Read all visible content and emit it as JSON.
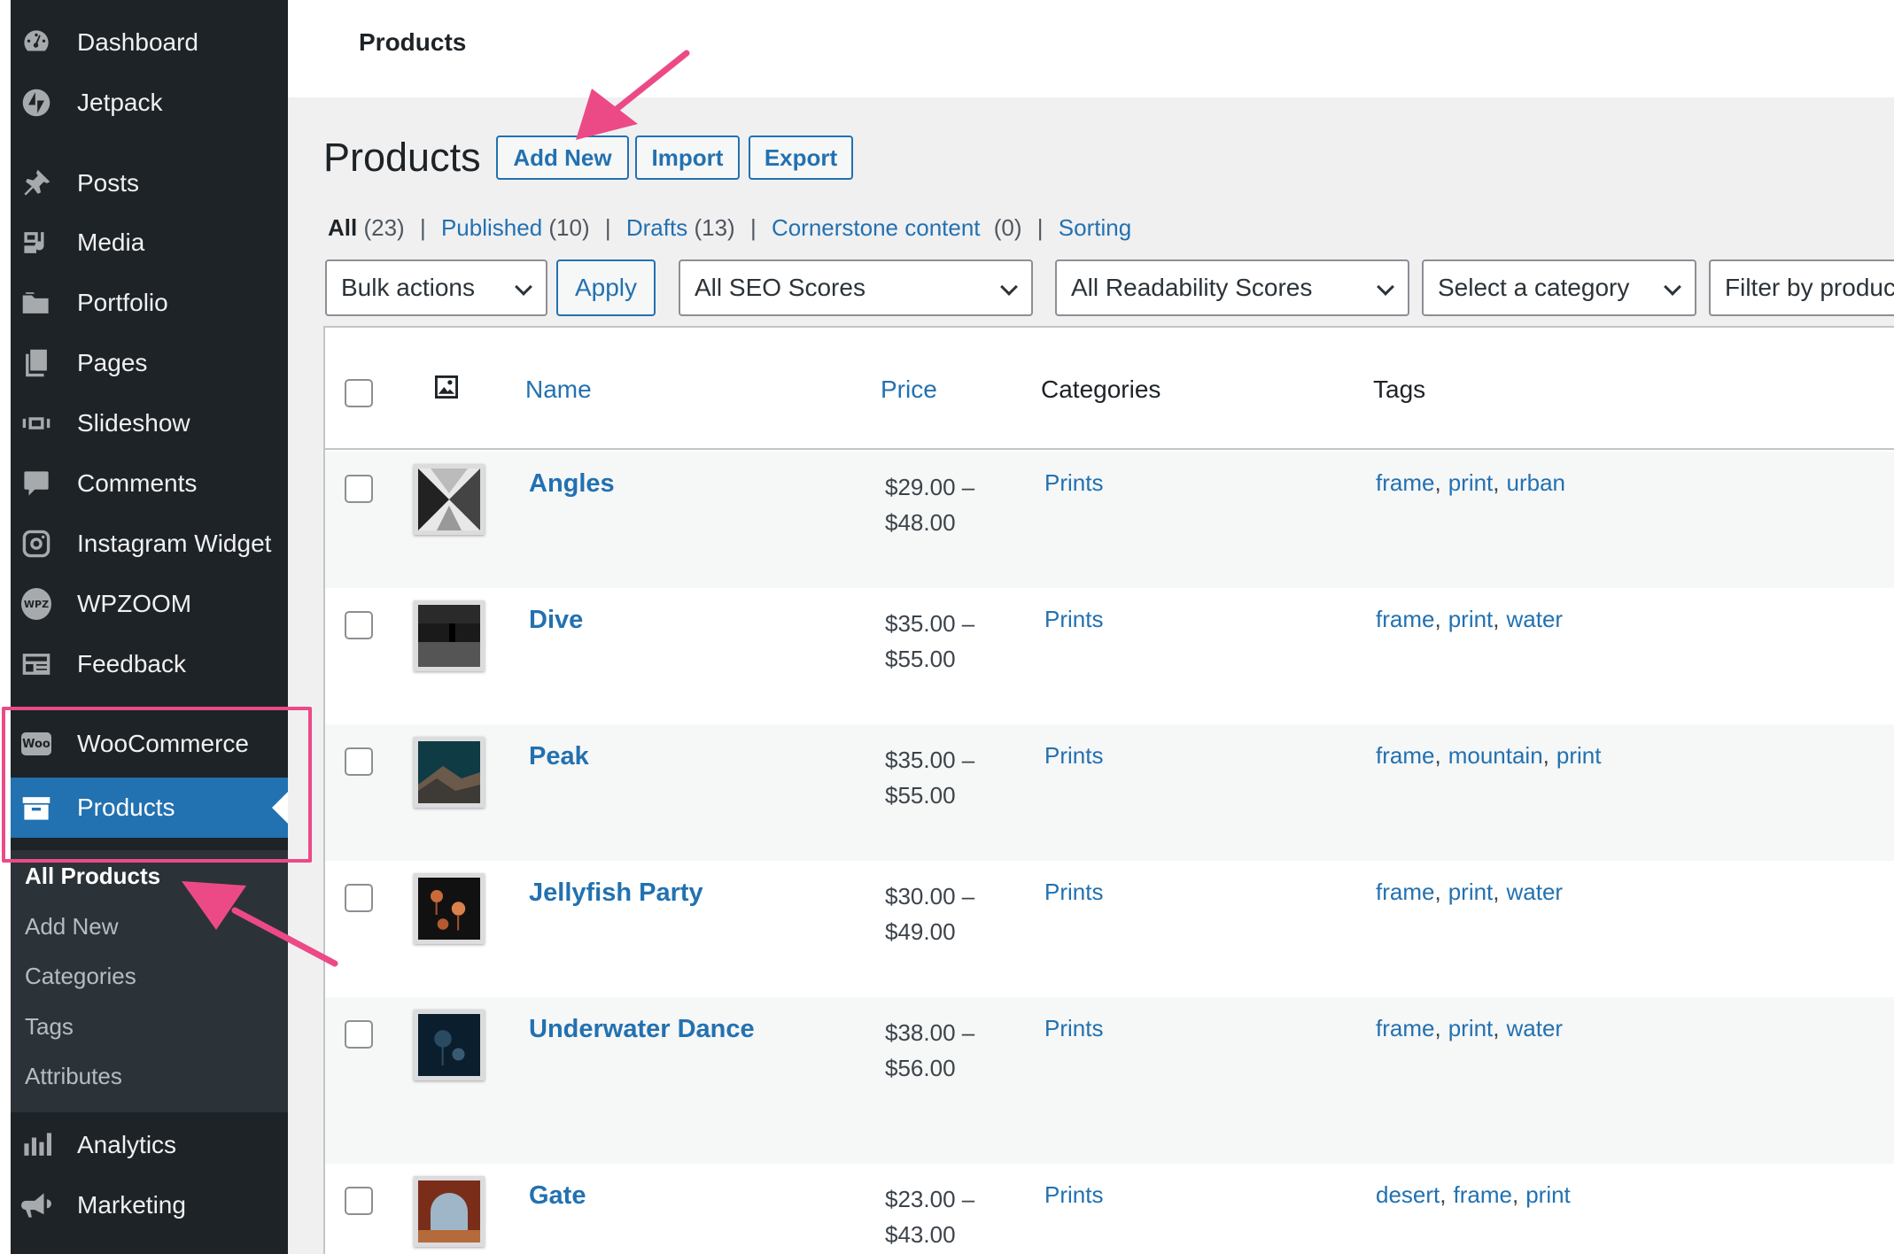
{
  "sidebar": {
    "items": [
      {
        "label": "Dashboard",
        "icon": "dashboard-icon"
      },
      {
        "label": "Jetpack",
        "icon": "jetpack-icon"
      },
      {
        "label": "Posts",
        "icon": "pin-icon"
      },
      {
        "label": "Media",
        "icon": "media-icon"
      },
      {
        "label": "Portfolio",
        "icon": "folder-icon"
      },
      {
        "label": "Pages",
        "icon": "pages-icon"
      },
      {
        "label": "Slideshow",
        "icon": "slideshow-icon"
      },
      {
        "label": "Comments",
        "icon": "comment-icon"
      },
      {
        "label": "Instagram Widget",
        "icon": "instagram-icon"
      },
      {
        "label": "WPZOOM",
        "icon": "wpzoom-icon"
      },
      {
        "label": "Feedback",
        "icon": "feedback-icon"
      },
      {
        "label": "WooCommerce",
        "icon": "woo-icon"
      },
      {
        "label": "Products",
        "icon": "archive-icon"
      },
      {
        "label": "Analytics",
        "icon": "bar-chart-icon"
      },
      {
        "label": "Marketing",
        "icon": "megaphone-icon"
      }
    ],
    "woo_badge": "Woo",
    "wpz_badge": "WPZ",
    "submenu": [
      "All Products",
      "Add New",
      "Categories",
      "Tags",
      "Attributes"
    ]
  },
  "topbar": {
    "title": "Products"
  },
  "header": {
    "title": "Products",
    "buttons": {
      "add_new": "Add New",
      "import": "Import",
      "export": "Export"
    }
  },
  "views": {
    "all": "All",
    "all_count": "(23)",
    "published": "Published",
    "published_count": "(10)",
    "drafts": "Drafts",
    "drafts_count": "(13)",
    "cornerstone": "Cornerstone content",
    "cornerstone_count": "(0)",
    "sorting": "Sorting",
    "separator": "|"
  },
  "filters": {
    "bulk_actions": "Bulk actions",
    "apply": "Apply",
    "seo": "All SEO Scores",
    "readability": "All Readability Scores",
    "category": "Select a category",
    "product_type": "Filter by product type"
  },
  "table": {
    "columns": {
      "name": "Name",
      "price": "Price",
      "categories": "Categories",
      "tags": "Tags"
    },
    "rows": [
      {
        "name": "Angles",
        "price_from": "$29.00 –",
        "price_to": "$48.00",
        "category": "Prints",
        "tags": [
          "frame",
          "print",
          "urban"
        ]
      },
      {
        "name": "Dive",
        "price_from": "$35.00 –",
        "price_to": "$55.00",
        "category": "Prints",
        "tags": [
          "frame",
          "print",
          "water"
        ]
      },
      {
        "name": "Peak",
        "price_from": "$35.00 –",
        "price_to": "$55.00",
        "category": "Prints",
        "tags": [
          "frame",
          "mountain",
          "print"
        ]
      },
      {
        "name": "Jellyfish Party",
        "price_from": "$30.00 –",
        "price_to": "$49.00",
        "category": "Prints",
        "tags": [
          "frame",
          "print",
          "water"
        ]
      },
      {
        "name": "Underwater Dance",
        "price_from": "$38.00 –",
        "price_to": "$56.00",
        "category": "Prints",
        "tags": [
          "frame",
          "print",
          "water"
        ]
      },
      {
        "name": "Gate",
        "price_from": "$23.00 –",
        "price_to": "$43.00",
        "category": "Prints",
        "tags": [
          "desert",
          "frame",
          "print"
        ]
      }
    ]
  },
  "colors": {
    "sidebar_bg": "#1d2327",
    "submenu_bg": "#2c3338",
    "accent": "#2271b1",
    "annotation": "#ec4a87",
    "content_bg": "#f0f0f1"
  }
}
